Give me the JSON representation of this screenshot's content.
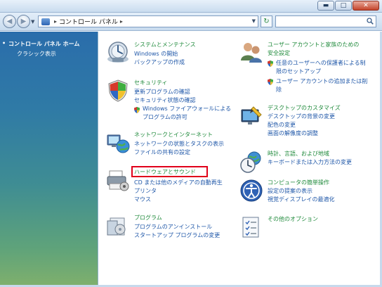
{
  "window": {
    "minimize_label": "▬",
    "maximize_label": "□",
    "close_label": "✕"
  },
  "address": {
    "separator": "▸",
    "current": "コントロール パネル",
    "after": "▸",
    "search_placeholder": ""
  },
  "sidebar": {
    "home": "コントロール パネル ホーム",
    "classic": "クラシック表示"
  },
  "categories": {
    "system": {
      "title": "システムとメンテナンス",
      "links": [
        "Windows の開始",
        "バックアップの作成"
      ]
    },
    "security": {
      "title": "セキュリティ",
      "links": [
        "更新プログラムの確認",
        "セキュリティ状態の確認",
        "Windows ファイアウォールによる",
        "プログラムの許可"
      ]
    },
    "network": {
      "title": "ネットワークとインターネット",
      "links": [
        "ネットワークの状態とタスクの表示",
        "ファイルの共有の設定"
      ]
    },
    "hardware": {
      "title": "ハードウェアとサウンド",
      "links": [
        "CD または他のメディアの自動再生",
        "プリンタ",
        "マウス"
      ]
    },
    "programs": {
      "title": "プログラム",
      "links": [
        "プログラムのアンインストール",
        "スタートアップ プログラムの変更"
      ]
    },
    "users": {
      "title": "ユーザー アカウントと家族のための",
      "title2": "安全設定",
      "links": [
        "任意のユーザーへの保護者による制",
        "限のセットアップ",
        "ユーザー アカウントの追加または削",
        "除"
      ]
    },
    "appearance": {
      "title": "デスクトップのカスタマイズ",
      "links": [
        "デスクトップの背景の変更",
        "配色の変更",
        "画面の解像度の調整"
      ]
    },
    "clock": {
      "title": "時計、言語、および地域",
      "links": [
        "キーボードまたは入力方法の変更"
      ]
    },
    "ease": {
      "title": "コンピュータの簡単操作",
      "links": [
        "設定の提案の表示",
        "視覚ディスプレイの最適化"
      ]
    },
    "other": {
      "title": "その他のオプション"
    }
  },
  "colors": {
    "category_title": "#1f8a3b",
    "link": "#1f57a8",
    "highlight_box": "#e0001a"
  }
}
